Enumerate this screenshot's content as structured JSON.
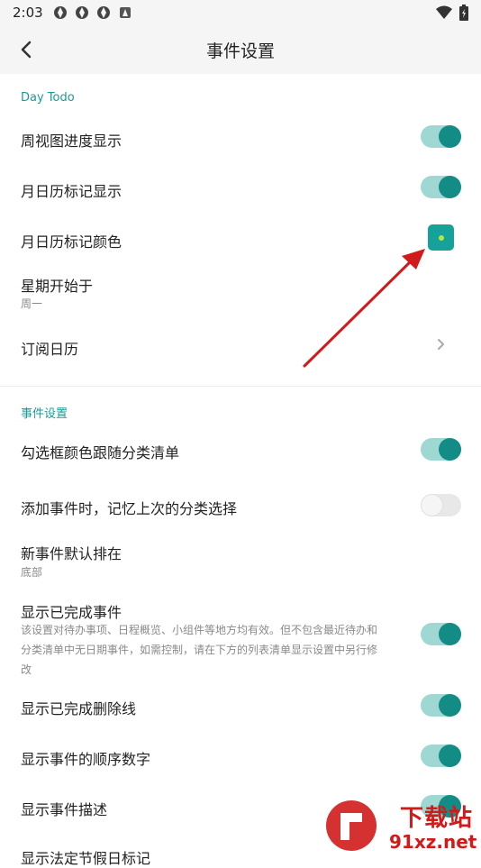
{
  "status_bar": {
    "time": "2:03"
  },
  "app_bar": {
    "title": "事件设置"
  },
  "sections": [
    {
      "header": "Day Todo",
      "rows": [
        {
          "title": "周视图进度显示",
          "control": "toggle",
          "on": true
        },
        {
          "title": "月日历标记显示",
          "control": "toggle",
          "on": true
        },
        {
          "title": "月日历标记颜色",
          "control": "color",
          "color": "#16a29b"
        },
        {
          "title": "星期开始于",
          "subtitle": "周一"
        },
        {
          "title": "订阅日历",
          "control": "chevron"
        }
      ]
    },
    {
      "header": "事件设置",
      "rows": [
        {
          "title": "勾选框颜色跟随分类清单",
          "control": "toggle",
          "on": true
        },
        {
          "title": "添加事件时，记忆上次的分类选择",
          "control": "toggle",
          "on": false
        },
        {
          "title": "新事件默认排在",
          "subtitle": "底部"
        },
        {
          "title": "显示已完成事件",
          "description_lines": [
            "该设置对待办事项、日程概览、小组件等地方均有效。但不包含最近待办和",
            "分类清单中无日期事件，如需控制，请在下方的列表清单显示设置中另行修",
            "改"
          ],
          "control": "toggle",
          "on": true
        },
        {
          "title": "显示已完成删除线",
          "control": "toggle",
          "on": true
        },
        {
          "title": "显示事件的顺序数字",
          "control": "toggle",
          "on": true
        },
        {
          "title": "显示事件描述",
          "control": "toggle",
          "on": true
        },
        {
          "title": "显示法定节假日标记"
        }
      ]
    }
  ],
  "watermark": {
    "text": "下载站",
    "url_text": "91xz.net"
  },
  "colors": {
    "accent": "#138c86",
    "toggle_track_on": "#9fd7d3",
    "section_header": "#1a9a96",
    "annotation_arrow": "#d11b1b"
  }
}
